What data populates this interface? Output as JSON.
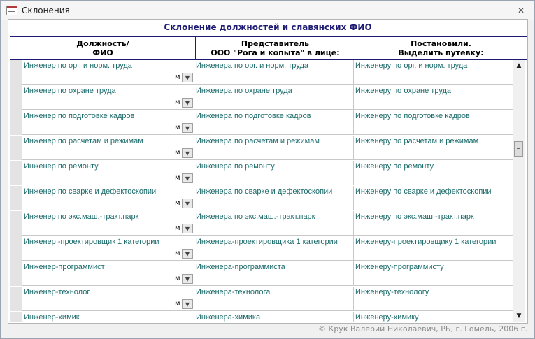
{
  "window": {
    "title": "Склонения"
  },
  "form": {
    "title": "Склонение должностей и славянских ФИО",
    "headers": [
      {
        "line1": "Должность/",
        "line2": "ФИО"
      },
      {
        "line1": "Представитель",
        "line2": "ООО \"Рога и копыта\" в лице:"
      },
      {
        "line1": "Постановили.",
        "line2": "Выделить путевку:"
      }
    ],
    "rows": [
      {
        "nominative": "Инженер по орг. и норм. труда",
        "gender": "м",
        "genitive": "Инженера по орг. и норм. труда",
        "dative": "Инженеру по орг. и норм. труда"
      },
      {
        "nominative": "Инженер по охране труда",
        "gender": "м",
        "genitive": "Инженера по охране труда",
        "dative": "Инженеру по охране труда"
      },
      {
        "nominative": "Инженер по подготовке кадров",
        "gender": "м",
        "genitive": "Инженера по подготовке кадров",
        "dative": "Инженеру по подготовке кадров"
      },
      {
        "nominative": "Инженер по расчетам и режимам",
        "gender": "м",
        "genitive": "Инженера по расчетам и режимам",
        "dative": "Инженеру по расчетам и режимам"
      },
      {
        "nominative": "Инженер по ремонту",
        "gender": "м",
        "genitive": "Инженера по ремонту",
        "dative": "Инженеру по ремонту"
      },
      {
        "nominative": "Инженер по сварке и дефектоскопии",
        "gender": "м",
        "genitive": "Инженера по сварке и дефектоскопии",
        "dative": "Инженеру по сварке и дефектоскопии"
      },
      {
        "nominative": "Инженер по экс.маш.-тракт.парк",
        "gender": "м",
        "genitive": "Инженера по экс.маш.-тракт.парк",
        "dative": "Инженеру по экс.маш.-тракт.парк"
      },
      {
        "nominative": "Инженер -проектировщик 1 категории",
        "gender": "м",
        "genitive": "Инженера-проектировщика 1 категории",
        "dative": "Инженеру-проектировщику 1 категории"
      },
      {
        "nominative": "Инженер-программист",
        "gender": "м",
        "genitive": "Инженера-программиста",
        "dative": "Инженеру-программисту"
      },
      {
        "nominative": "Инженер-технолог",
        "gender": "м",
        "genitive": "Инженера-технолога",
        "dative": "Инженеру-технологу"
      },
      {
        "nominative": "Инженер-химик",
        "gender": "",
        "genitive": "Инженера-химика",
        "dative": "Инженеру-химику"
      }
    ]
  },
  "footer": {
    "copyright": "© Крук Валерий Николаевич, РБ, г. Гомель, 2006 г."
  },
  "colors": {
    "title_text": "#1c1a72",
    "cell_text": "#1c6b6b",
    "header_border": "#1c1a72"
  },
  "icons": {
    "close": "close-icon",
    "combo": "chevron-down-icon",
    "scroll_up": "arrow-up-icon",
    "scroll_down": "arrow-down-icon"
  }
}
